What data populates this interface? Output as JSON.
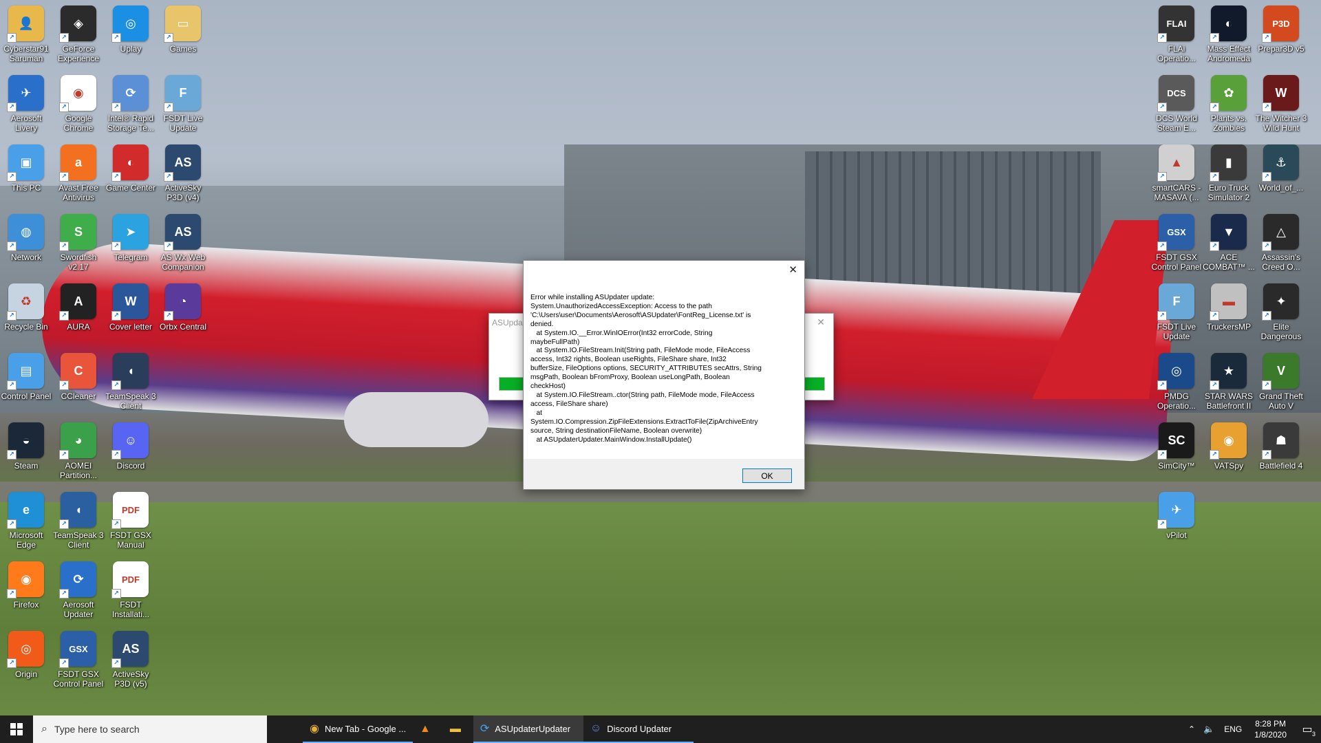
{
  "desktop_left": [
    {
      "label": "Cyberstar91 Saruman",
      "icon": "user-folder-icon",
      "color": "#e8b84a",
      "glyph": "👤"
    },
    {
      "label": "GeForce Experience",
      "icon": "nvidia-icon",
      "color": "#2b2b2b",
      "glyph": "◈"
    },
    {
      "label": "Uplay",
      "icon": "uplay-icon",
      "color": "#1a8fe3",
      "glyph": "◎"
    },
    {
      "label": "Games",
      "icon": "folder-icon",
      "color": "#e8c46a",
      "glyph": "▭"
    },
    {
      "label": "Aerosoft Livery",
      "icon": "aerosoft-livery-icon",
      "color": "#2a6fc9",
      "glyph": "✈"
    },
    {
      "label": "Google Chrome",
      "icon": "chrome-icon",
      "color": "#ffffff",
      "glyph": "◉"
    },
    {
      "label": "Intel® Rapid Storage Te...",
      "icon": "intel-rst-icon",
      "color": "#5b8fd6",
      "glyph": "⟳"
    },
    {
      "label": "FSDT Live Update",
      "icon": "fsdt-update-icon",
      "color": "#6aa8d8",
      "glyph": "F"
    },
    {
      "label": "This PC",
      "icon": "this-pc-icon",
      "color": "#4aa0e8",
      "glyph": "▣"
    },
    {
      "label": "Avast Free Antivirus",
      "icon": "avast-icon",
      "color": "#f2701f",
      "glyph": "a"
    },
    {
      "label": "Game Center",
      "icon": "game-center-icon",
      "color": "#d22b2b",
      "glyph": "◐"
    },
    {
      "label": "ActiveSky P3D (v4)",
      "icon": "activesky-icon",
      "color": "#2c4a70",
      "glyph": "AS"
    },
    {
      "label": "Network",
      "icon": "network-icon",
      "color": "#3d8fd8",
      "glyph": "◍"
    },
    {
      "label": "Swordfish v2.17",
      "icon": "swordfish-icon",
      "color": "#3fae4a",
      "glyph": "S"
    },
    {
      "label": "Telegram",
      "icon": "telegram-icon",
      "color": "#2aa3e0",
      "glyph": "➤"
    },
    {
      "label": "AS Wx Web Companion",
      "icon": "as-wx-icon",
      "color": "#2c4a70",
      "glyph": "AS"
    },
    {
      "label": "Recycle Bin",
      "icon": "recycle-bin-icon",
      "color": "#c6d3e0",
      "glyph": "♻"
    },
    {
      "label": "AURA",
      "icon": "aura-icon",
      "color": "#222222",
      "glyph": "A"
    },
    {
      "label": "Cover letter",
      "icon": "word-doc-icon",
      "color": "#2b579a",
      "glyph": "W"
    },
    {
      "label": "Orbx Central",
      "icon": "orbx-icon",
      "color": "#5a3a9a",
      "glyph": "◔"
    },
    {
      "label": "Control Panel",
      "icon": "control-panel-icon",
      "color": "#4aa0e8",
      "glyph": "▤"
    },
    {
      "label": "CCleaner",
      "icon": "ccleaner-icon",
      "color": "#e8553a",
      "glyph": "C"
    },
    {
      "label": "TeamSpeak 3 Client",
      "icon": "teamspeak-icon",
      "color": "#2a3d5a",
      "glyph": "◖"
    },
    {
      "label": "",
      "icon": "blank-icon",
      "color": "transparent",
      "glyph": ""
    },
    {
      "label": "Steam",
      "icon": "steam-icon",
      "color": "#1b2838",
      "glyph": "◒"
    },
    {
      "label": "AOMEI Partition...",
      "icon": "aomei-icon",
      "color": "#3aa04a",
      "glyph": "◕"
    },
    {
      "label": "Discord",
      "icon": "discord-icon",
      "color": "#5865f2",
      "glyph": "☺"
    },
    {
      "label": "",
      "icon": "blank-icon",
      "color": "transparent",
      "glyph": ""
    },
    {
      "label": "Microsoft Edge",
      "icon": "edge-icon",
      "color": "#1f8fd6",
      "glyph": "e"
    },
    {
      "label": "TeamSpeak 3 Client",
      "icon": "teamspeak-icon",
      "color": "#2a5fa0",
      "glyph": "◖"
    },
    {
      "label": "FSDT GSX Manual",
      "icon": "pdf-icon",
      "color": "#ffffff",
      "glyph": "PDF"
    },
    {
      "label": "",
      "icon": "blank-icon",
      "color": "transparent",
      "glyph": ""
    },
    {
      "label": "Firefox",
      "icon": "firefox-icon",
      "color": "#ff7a1a",
      "glyph": "◉"
    },
    {
      "label": "Aerosoft Updater",
      "icon": "aerosoft-updater-icon",
      "color": "#2a6fc9",
      "glyph": "⟳"
    },
    {
      "label": "FSDT Installati...",
      "icon": "pdf-icon",
      "color": "#ffffff",
      "glyph": "PDF"
    },
    {
      "label": "",
      "icon": "blank-icon",
      "color": "transparent",
      "glyph": ""
    },
    {
      "label": "Origin",
      "icon": "origin-icon",
      "color": "#f25a1a",
      "glyph": "◎"
    },
    {
      "label": "FSDT GSX Control Panel",
      "icon": "gsx-icon",
      "color": "#2b5fa8",
      "glyph": "GSX"
    },
    {
      "label": "ActiveSky P3D (v5)",
      "icon": "activesky-icon",
      "color": "#2c4a70",
      "glyph": "AS"
    }
  ],
  "desktop_right": [
    {
      "label": "FLAi Operatio...",
      "icon": "flai-icon",
      "color": "#333333",
      "glyph": "FLAI"
    },
    {
      "label": "Mass Effect Andromeda",
      "icon": "mass-effect-icon",
      "color": "#101a2a",
      "glyph": "◐"
    },
    {
      "label": "Prepar3D v5",
      "icon": "prepar3d-icon",
      "color": "#d34a1f",
      "glyph": "P3D"
    },
    {
      "label": "DCS World Steam E...",
      "icon": "dcs-icon",
      "color": "#5a5a5a",
      "glyph": "DCS"
    },
    {
      "label": "Plants vs. Zombies",
      "icon": "pvz-icon",
      "color": "#5aa03a",
      "glyph": "✿"
    },
    {
      "label": "The Witcher 3 Wild Hunt",
      "icon": "witcher-icon",
      "color": "#6a1a1a",
      "glyph": "W"
    },
    {
      "label": "smartCARS - MASAVA (...",
      "icon": "smartcars-icon",
      "color": "#d0d0d0",
      "glyph": "▲"
    },
    {
      "label": "Euro Truck Simulator 2",
      "icon": "ets2-icon",
      "color": "#3a3a3a",
      "glyph": "▮"
    },
    {
      "label": "World_of_...",
      "icon": "world-of-warships-icon",
      "color": "#2a4a5a",
      "glyph": "⚓"
    },
    {
      "label": "FSDT GSX Control Panel",
      "icon": "gsx-icon",
      "color": "#2b5fa8",
      "glyph": "GSX"
    },
    {
      "label": "ACE COMBAT™ ...",
      "icon": "ace-combat-icon",
      "color": "#1a2a4a",
      "glyph": "▼"
    },
    {
      "label": "Assassin's Creed O...",
      "icon": "assassins-creed-icon",
      "color": "#2a2a2a",
      "glyph": "△"
    },
    {
      "label": "FSDT Live Update",
      "icon": "fsdt-update-icon",
      "color": "#6aa8d8",
      "glyph": "F"
    },
    {
      "label": "TruckersMP",
      "icon": "truckersmp-icon",
      "color": "#c0c0c0",
      "glyph": "▬"
    },
    {
      "label": "Elite Dangerous",
      "icon": "elite-icon",
      "color": "#2a2a2a",
      "glyph": "✦"
    },
    {
      "label": "PMDG Operatio...",
      "icon": "pmdg-icon",
      "color": "#1a4a8a",
      "glyph": "◎"
    },
    {
      "label": "STAR WARS Battlefront II",
      "icon": "star-wars-icon",
      "color": "#1a2a3a",
      "glyph": "★"
    },
    {
      "label": "Grand Theft Auto V",
      "icon": "gta-icon",
      "color": "#3a7a2a",
      "glyph": "V"
    },
    {
      "label": "SimCity™",
      "icon": "simcity-icon",
      "color": "#1a1a1a",
      "glyph": "SC"
    },
    {
      "label": "VATSpy",
      "icon": "vatspy-icon",
      "color": "#e8a030",
      "glyph": "◉"
    },
    {
      "label": "Battlefield 4",
      "icon": "battlefield-icon",
      "color": "#3a3a3a",
      "glyph": "☗"
    },
    {
      "label": "vPilot",
      "icon": "vpilot-icon",
      "color": "#4aa0e8",
      "glyph": "✈"
    }
  ],
  "background_dialog": {
    "title": "ASUpdat",
    "close_glyph": "✕",
    "progress": 1.0
  },
  "error_dialog": {
    "close_glyph": "✕",
    "lines": [
      "Error while installing ASUpdater update:",
      "System.UnauthorizedAccessException: Access to the path",
      "'C:\\Users\\user\\Documents\\Aerosoft\\ASUpdater\\FontReg_License.txt' is",
      "denied.",
      "   at System.IO.__Error.WinIOError(Int32 errorCode, String",
      "maybeFullPath)",
      "   at System.IO.FileStream.Init(String path, FileMode mode, FileAccess",
      "access, Int32 rights, Boolean useRights, FileShare share, Int32",
      "bufferSize, FileOptions options, SECURITY_ATTRIBUTES secAttrs, String",
      "msgPath, Boolean bFromProxy, Boolean useLongPath, Boolean",
      "checkHost)",
      "   at System.IO.FileStream..ctor(String path, FileMode mode, FileAccess",
      "access, FileShare share)",
      "   at",
      "System.IO.Compression.ZipFileExtensions.ExtractToFile(ZipArchiveEntry",
      "source, String destinationFileName, Boolean overwrite)",
      "   at ASUpdaterUpdater.MainWindow.InstallUpdate()"
    ],
    "ok_label": "OK"
  },
  "taskbar": {
    "search_placeholder": "Type here to search",
    "apps": [
      {
        "label": "New Tab - Google ...",
        "icon": "chrome-icon",
        "state": "open"
      },
      {
        "label": "",
        "icon": "vlc-icon",
        "state": "pinned"
      },
      {
        "label": "",
        "icon": "file-explorer-icon",
        "state": "pinned"
      },
      {
        "label": "ASUpdaterUpdater",
        "icon": "asupdater-icon",
        "state": "active"
      },
      {
        "label": "Discord Updater",
        "icon": "discord-icon",
        "state": "open"
      }
    ],
    "tray": {
      "language": "ENG",
      "time": "8:28 PM",
      "date": "1/8/2020",
      "notification_count": "3"
    }
  }
}
